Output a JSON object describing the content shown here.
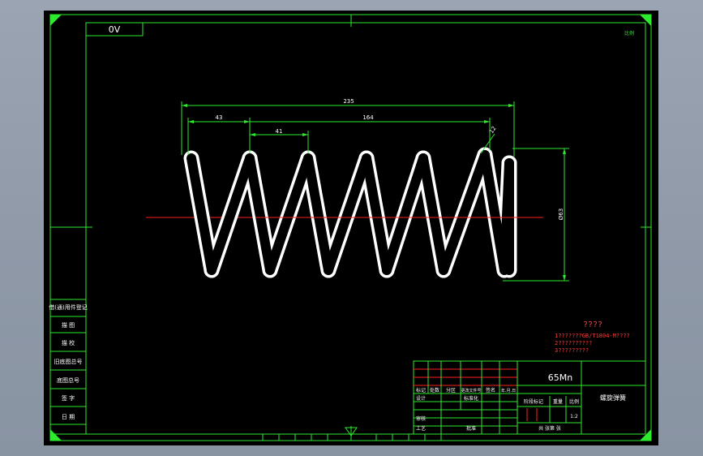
{
  "drawing": {
    "sheet_code": "0V",
    "corner_mark": "比例",
    "material": "65Mn",
    "part_name": "螺旋弹簧",
    "dimensions": {
      "overall_length": "235",
      "pitch_span": "164",
      "end_offset": "43",
      "pitch": "41",
      "wire_dia": "12",
      "outer_dia": "Ø63"
    },
    "notes": {
      "title": "????",
      "line1": "1???????GB/T1804-M????",
      "line2": "2??????????",
      "line3": "3?????????"
    },
    "side_labels": [
      "借(通)用件登记",
      "描 图",
      "描 校",
      "旧底图总号",
      "底图总号",
      "签 字",
      "日 期"
    ],
    "title_block": {
      "col_headers": [
        "标记",
        "处数",
        "分区",
        "更改文件号",
        "签名",
        "年.月.日"
      ],
      "design": "设计",
      "standardize": "标准化",
      "review": "审核",
      "process": "工艺",
      "approve": "批准",
      "stage_mark": "阶段标记",
      "weight": "重量",
      "scale": "比例",
      "scale_value": "1:2",
      "sheets": "共 张第 张"
    }
  }
}
